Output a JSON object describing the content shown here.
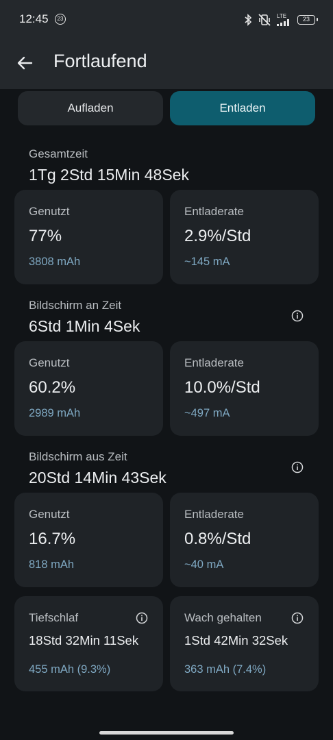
{
  "status": {
    "time": "12:45",
    "notification_badge": "23",
    "network": "LTE",
    "battery": "23"
  },
  "header": {
    "title": "Fortlaufend"
  },
  "tabs": {
    "charge": "Aufladen",
    "discharge": "Entladen",
    "selected": "discharge"
  },
  "colors": {
    "accent": "#0e5d6e",
    "card": "#1f2327",
    "sub_text": "#7fa8c2"
  },
  "total": {
    "label": "Gesamtzeit",
    "value": "1Tg 2Std 15Min 48Sek",
    "used": {
      "label": "Genutzt",
      "value": "77%",
      "sub": "3808 mAh"
    },
    "rate": {
      "label": "Entladerate",
      "value": "2.9%/Std",
      "sub": "~145 mA"
    }
  },
  "screen_on": {
    "label": "Bildschirm an Zeit",
    "value": "6Std 1Min 4Sek",
    "used": {
      "label": "Genutzt",
      "value": "60.2%",
      "sub": "2989 mAh"
    },
    "rate": {
      "label": "Entladerate",
      "value": "10.0%/Std",
      "sub": "~497 mA"
    }
  },
  "screen_off": {
    "label": "Bildschirm aus Zeit",
    "value": "20Std 14Min 43Sek",
    "used": {
      "label": "Genutzt",
      "value": "16.7%",
      "sub": "818 mAh"
    },
    "rate": {
      "label": "Entladerate",
      "value": "0.8%/Std",
      "sub": "~40 mA"
    }
  },
  "deep_sleep": {
    "label": "Tiefschlaf",
    "value": "18Std 32Min 11Sek",
    "sub": "455 mAh (9.3%)"
  },
  "awake": {
    "label": "Wach gehalten",
    "value": "1Std 42Min 32Sek",
    "sub": "363 mAh (7.4%)"
  }
}
